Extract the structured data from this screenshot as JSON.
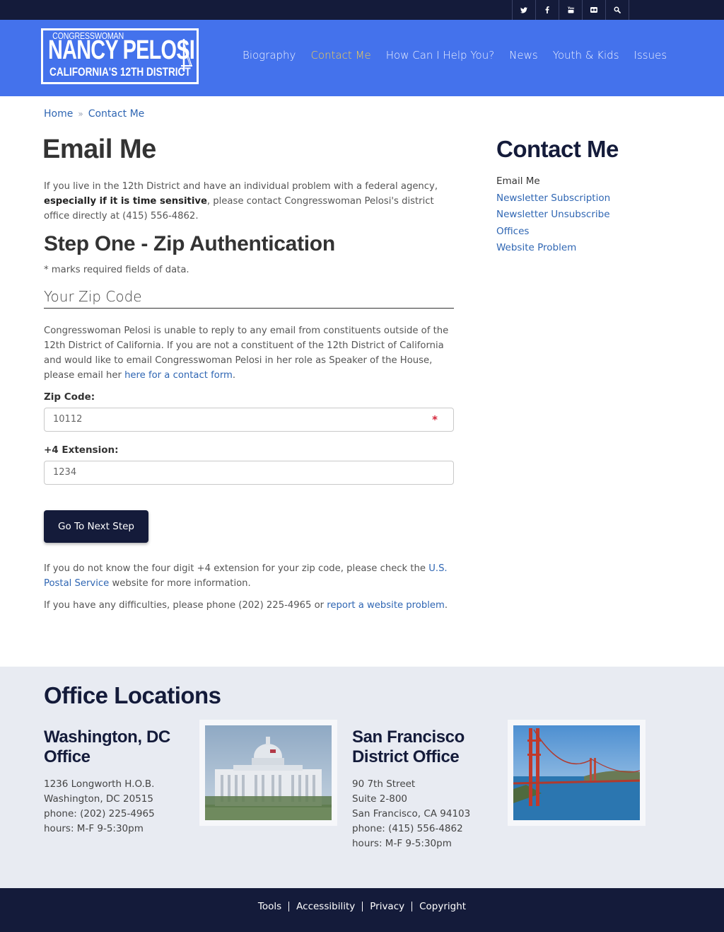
{
  "social": {
    "items": [
      {
        "icon": "twitter-icon"
      },
      {
        "icon": "facebook-icon"
      },
      {
        "icon": "youtube-icon"
      },
      {
        "icon": "flickr-icon"
      },
      {
        "icon": "search-icon"
      }
    ]
  },
  "logo": {
    "line1": "CONGRESSWOMAN",
    "line2": "NANCY PELOSI",
    "line3": "CALIFORNIA'S 12TH DISTRICT"
  },
  "nav": {
    "items": [
      {
        "label": "Biography"
      },
      {
        "label": "Contact Me"
      },
      {
        "label": "How Can I Help You?"
      },
      {
        "label": "News"
      },
      {
        "label": "Youth & Kids"
      },
      {
        "label": "Issues"
      }
    ],
    "active_index": 1
  },
  "breadcrumb": {
    "home": "Home",
    "separator": "»",
    "current": "Contact Me"
  },
  "main": {
    "title": "Email Me",
    "intro_before": "If you live in the 12th District and have an individual problem with a federal agency, ",
    "intro_bold": "especially if it is time sensitive",
    "intro_after": ", please contact Congresswoman Pelosi's district office directly at (415) 556-4862.",
    "step_title": "Step One - Zip Authentication",
    "required_note": "* marks required fields of data.",
    "legend": "Your Zip Code",
    "notice_before": "Congresswoman Pelosi is unable to reply to any email from constituents outside of the 12th District of California. If you are not a constituent of the 12th District of California and would like to email Congresswoman Pelosi in her role as Speaker of the House, please email her ",
    "notice_link": "here for a contact form",
    "notice_after": ".",
    "zip_label": "Zip Code:",
    "zip_value": "10112",
    "required_mark": "*",
    "ext_label": "+4 Extension:",
    "ext_value": "1234",
    "button_label": "Go To Next Step",
    "help1_before": "If you do not know the four digit +4 extension for your zip code, please check the ",
    "help1_link": "U.S. Postal Service",
    "help1_after": " website for more information.",
    "help2_before": "If you have any difficulties, please phone (202) 225-4965 or ",
    "help2_link": "report a website problem",
    "help2_after": "."
  },
  "sidebar": {
    "title": "Contact Me",
    "items": [
      {
        "label": "Email Me"
      },
      {
        "label": "Newsletter Subscription"
      },
      {
        "label": "Newsletter Unsubscribe"
      },
      {
        "label": "Offices"
      },
      {
        "label": "Website Problem"
      }
    ]
  },
  "offices": {
    "title": "Office Locations",
    "dc": {
      "name": "Washington, DC Office",
      "line1": "1236 Longworth H.O.B.",
      "line2": "Washington, DC 20515",
      "phone": "phone: (202) 225-4965",
      "hours": "hours: M-F 9-5:30pm"
    },
    "sf": {
      "name": "San Francisco District Office",
      "line1": "90 7th Street",
      "line2": "Suite 2-800",
      "line3": "San Francisco, CA 94103",
      "phone": "phone: (415) 556-4862",
      "hours": "hours: M-F 9-5:30pm"
    }
  },
  "footer": {
    "links": [
      {
        "label": "Tools"
      },
      {
        "label": "Accessibility"
      },
      {
        "label": "Privacy"
      },
      {
        "label": "Copyright"
      }
    ]
  },
  "colors": {
    "header_blue": "#4472ec",
    "navy": "#141b3a",
    "nav_active": "#f3cd52",
    "link": "#2f66b3",
    "required": "#d5263a",
    "offices_bg": "#e8ebf2"
  }
}
